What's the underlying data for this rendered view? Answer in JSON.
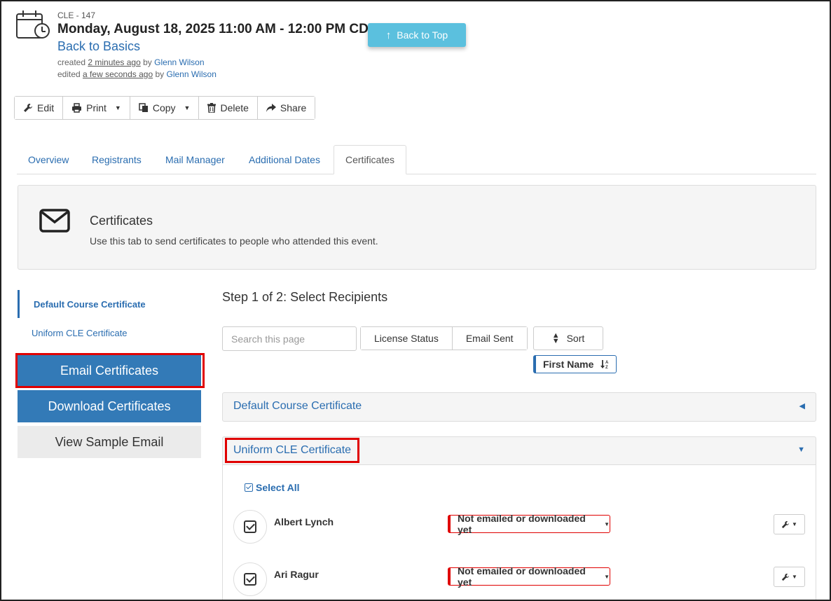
{
  "header": {
    "code": "CLE - 147",
    "datetime": "Monday, August 18, 2025 11:00 AM - 12:00 PM CDT",
    "title": "Back to Basics",
    "created_prefix": "created",
    "created_ago": "2 minutes ago",
    "created_by_prefix": "by",
    "created_by": "Glenn Wilson",
    "edited_prefix": "edited",
    "edited_ago": "a few seconds ago",
    "edited_by_prefix": "by",
    "edited_by": "Glenn Wilson"
  },
  "back_to_top": {
    "label": "Back to Top",
    "arrow_glyph": "↑"
  },
  "toolbar": {
    "edit_label": "Edit",
    "print_label": "Print",
    "copy_label": "Copy",
    "delete_label": "Delete",
    "share_label": "Share"
  },
  "tabs": [
    {
      "label": "Overview",
      "active": false
    },
    {
      "label": "Registrants",
      "active": false
    },
    {
      "label": "Mail Manager",
      "active": false
    },
    {
      "label": "Additional Dates",
      "active": false
    },
    {
      "label": "Certificates",
      "active": true
    }
  ],
  "banner": {
    "title": "Certificates",
    "description": "Use this tab to send certificates to people who attended this event."
  },
  "sidebar": {
    "items": [
      {
        "label": "Default Course Certificate",
        "active": true
      },
      {
        "label": "Uniform CLE Certificate",
        "active": false
      }
    ],
    "email_button": "Email Certificates",
    "download_button": "Download Certificates",
    "sample_button": "View Sample Email"
  },
  "main": {
    "step_title": "Step 1 of 2: Select Recipients",
    "search_placeholder": "Search this page",
    "filters": [
      "License Status",
      "Email Sent"
    ],
    "sort_label": "Sort",
    "sort_field": "First Name",
    "panels": [
      {
        "title": "Default Course Certificate",
        "expanded": false
      },
      {
        "title": "Uniform CLE Certificate",
        "expanded": true
      }
    ],
    "select_all": "Select All",
    "recipients": [
      {
        "name": "Albert Lynch",
        "status": "Not emailed or downloaded yet"
      },
      {
        "name": "Ari Ragur",
        "status": "Not emailed or downloaded yet"
      }
    ]
  },
  "colors": {
    "link_blue": "#2a6db0",
    "primary_button": "#337ab7",
    "info_button": "#5bc0de",
    "highlight_red": "#e00000"
  }
}
